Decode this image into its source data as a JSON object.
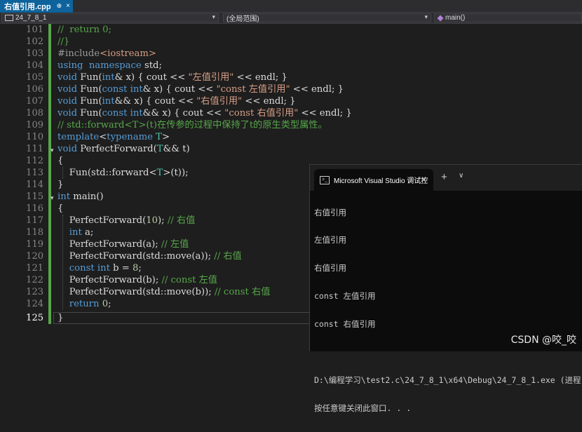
{
  "tab": {
    "filename": "右值引用.cpp",
    "pin": "⊕",
    "close": "×"
  },
  "navbar": {
    "project": "24_7_8_1",
    "scope": "(全局范围)",
    "member": "main()"
  },
  "editor": {
    "line_numbers": [
      "101",
      "102",
      "103",
      "104",
      "105",
      "106",
      "107",
      "108",
      "109",
      "110",
      "111",
      "112",
      "113",
      "114",
      "115",
      "116",
      "117",
      "118",
      "119",
      "120",
      "121",
      "122",
      "123",
      "124",
      "125"
    ],
    "current_line": "125"
  },
  "console": {
    "tab_title": "Microsoft Visual Studio 调试控",
    "close": "×",
    "new_tab": "+",
    "dropdown": "∨",
    "output": [
      "右值引用",
      "左值引用",
      "右值引用",
      "const 左值引用",
      "const 右值引用",
      "",
      "D:\\编程学习\\test2.c\\24_7_8_1\\x64\\Debug\\24_7_8_1.exe (进程",
      "按任意键关闭此窗口. . ."
    ]
  },
  "watermark": "CSDN @咬_咬",
  "colors": {
    "accent": "#0e639c",
    "keyword": "#569cd6",
    "comment": "#57a64a",
    "string": "#d69d85",
    "type": "#4ec9b0",
    "change_bar": "#57a64a"
  }
}
